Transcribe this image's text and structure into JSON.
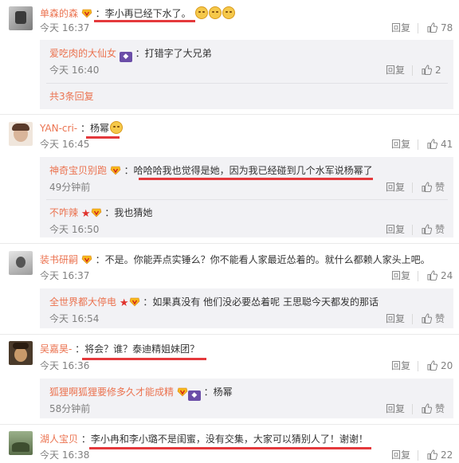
{
  "comments": [
    {
      "user": "单森的森",
      "text": "：李小再已经下水了。",
      "time": "今天 16:37",
      "reply_label": "回复",
      "likes": "78",
      "replies": [
        {
          "user": "爱吃肉的大仙女",
          "text": "：打错字了大兄弟",
          "time": "今天 16:40",
          "reply_label": "回复",
          "likes": "2"
        }
      ],
      "more_replies": "共3条回复"
    },
    {
      "user": "YAN-cri-",
      "text": "：杨幂",
      "time": "今天 16:45",
      "reply_label": "回复",
      "likes": "41",
      "replies": [
        {
          "user": "神奇宝贝别跑",
          "text": "：哈哈哈我也觉得是她，因为我已经碰到几个水军说杨幂了",
          "time": "49分钟前",
          "reply_label": "回复",
          "likes": "赞"
        },
        {
          "user": "不咋辣",
          "text": "：我也猜她",
          "time": "今天 16:50",
          "reply_label": "回复",
          "likes": "赞"
        }
      ]
    },
    {
      "user": "装书研嗣",
      "text": "：不是。你能弄点实锤么？你不能看人家最近怂着的。就什么都赖人家头上吧。",
      "time": "今天 16:37",
      "reply_label": "回复",
      "likes": "24",
      "replies": [
        {
          "user": "全世界都大停电",
          "text": "：如果真没有 他们没必要怂着呢 王思聪今天都发的那话",
          "time": "今天 16:54",
          "reply_label": "回复",
          "likes": "赞"
        }
      ]
    },
    {
      "user": "吴嘉昊-",
      "text": "：将会？谁？泰迪精姐妹团？",
      "time": "今天 16:36",
      "reply_label": "回复",
      "likes": "20",
      "replies": [
        {
          "user": "狐狸啊狐狸要修多久才能成精",
          "text": "：杨幂",
          "time": "58分钟前",
          "reply_label": "回复",
          "likes": "赞"
        }
      ]
    },
    {
      "user": "湖人宝贝",
      "text": "：李小冉和李小璐不是闺蜜，没有交集，大家可以猜别人了！谢谢！",
      "time": "今天 16:38",
      "reply_label": "回复",
      "likes": "22",
      "replies": []
    }
  ],
  "icons": {
    "thumb": "thumbs-up-icon",
    "vip": "vip-badge-icon",
    "verified": "weibo-v-icon",
    "emoji": "cat-face-emoji",
    "star": "star-icon"
  },
  "colors": {
    "username": "#eb7350",
    "time": "#808080",
    "reply_bg": "#f2f2f5",
    "highlight_underline": "#e4393c"
  }
}
